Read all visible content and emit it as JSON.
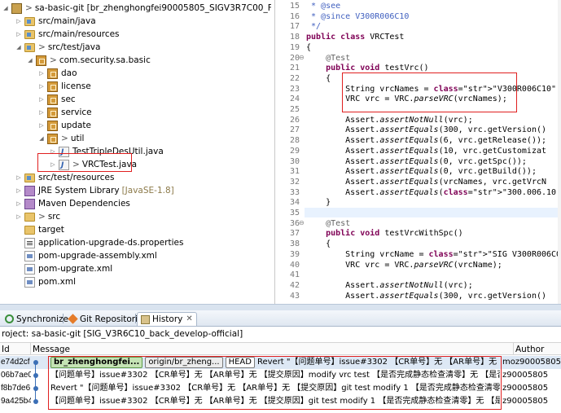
{
  "explorer": {
    "items": [
      {
        "label": "sa-basic-git [br_zhenghongfei90005805_SIGV3R7C00_F1]",
        "prefix": ">",
        "icon": "project-icon",
        "twisty": "expanded"
      },
      {
        "label": "src/main/java",
        "prefix": "",
        "icon": "source-folder-icon",
        "twisty": "collapsed"
      },
      {
        "label": "src/main/resources",
        "prefix": "",
        "icon": "source-folder-icon",
        "twisty": "collapsed"
      },
      {
        "label": "src/test/java",
        "prefix": ">",
        "icon": "source-folder-icon",
        "twisty": "expanded"
      },
      {
        "label": "com.security.sa.basic",
        "prefix": ">",
        "icon": "package-icon",
        "twisty": "expanded"
      },
      {
        "label": "dao",
        "prefix": "",
        "icon": "package-icon",
        "twisty": "collapsed"
      },
      {
        "label": "license",
        "prefix": "",
        "icon": "package-icon",
        "twisty": "collapsed"
      },
      {
        "label": "sec",
        "prefix": "",
        "icon": "package-icon",
        "twisty": "collapsed"
      },
      {
        "label": "service",
        "prefix": "",
        "icon": "package-icon",
        "twisty": "collapsed"
      },
      {
        "label": "update",
        "prefix": "",
        "icon": "package-icon",
        "twisty": "collapsed"
      },
      {
        "label": "util",
        "prefix": ">",
        "icon": "package-icon",
        "twisty": "expanded"
      },
      {
        "label": "TestTripleDesUtil.java",
        "prefix": "",
        "icon": "java-file-icon",
        "twisty": "collapsed"
      },
      {
        "label": "VRCTest.java",
        "prefix": ">",
        "icon": "java-file-icon",
        "twisty": "collapsed"
      },
      {
        "label": "src/test/resources",
        "prefix": "",
        "icon": "source-folder-icon",
        "twisty": "collapsed"
      },
      {
        "label": "JRE System Library",
        "suffix": "[JavaSE-1.8]",
        "prefix": "",
        "icon": "library-icon",
        "twisty": "collapsed"
      },
      {
        "label": "Maven Dependencies",
        "prefix": "",
        "icon": "library-icon",
        "twisty": "collapsed"
      },
      {
        "label": "src",
        "prefix": ">",
        "icon": "folder-icon",
        "twisty": "collapsed"
      },
      {
        "label": "target",
        "prefix": "",
        "icon": "folder-icon",
        "twisty": "none"
      },
      {
        "label": "application-upgrade-ds.properties",
        "prefix": "",
        "icon": "properties-file-icon",
        "twisty": "none"
      },
      {
        "label": "pom-upgrade-assembly.xml",
        "prefix": "",
        "icon": "xml-file-icon",
        "twisty": "none"
      },
      {
        "label": "pom-upgrate.xml",
        "prefix": "",
        "icon": "xml-file-icon",
        "twisty": "none"
      },
      {
        "label": "pom.xml",
        "prefix": "",
        "icon": "xml-file-icon",
        "twisty": "none"
      }
    ]
  },
  "editor": {
    "lines": [
      {
        "n": "15",
        "code": " * @see",
        "style": "comment"
      },
      {
        "n": "16",
        "code": " * @since V300R006C10",
        "style": "comment"
      },
      {
        "n": "17",
        "code": " */",
        "style": "comment"
      },
      {
        "n": "18",
        "code": "public class VRCTest",
        "style": "class"
      },
      {
        "n": "19",
        "code": "{",
        "style": "plain"
      },
      {
        "n": "20",
        "code": "    @Test",
        "style": "annotation",
        "fold": true
      },
      {
        "n": "21",
        "code": "    public void testVrc()",
        "style": "method"
      },
      {
        "n": "22",
        "code": "    {",
        "style": "plain"
      },
      {
        "n": "23",
        "code": "        String vrcNames = \"V300R006C10\";",
        "style": "string-assign"
      },
      {
        "n": "24",
        "code": "        VRC vrc = VRC.parseVRC(vrcNames);",
        "style": "italic-call"
      },
      {
        "n": "25",
        "code": "",
        "style": "plain"
      },
      {
        "n": "26",
        "code": "        Assert.assertNotNull(vrc);",
        "style": "italic-call"
      },
      {
        "n": "27",
        "code": "        Assert.assertEquals(300, vrc.getVersion()",
        "style": "italic-call"
      },
      {
        "n": "28",
        "code": "        Assert.assertEquals(6, vrc.getRelease());",
        "style": "italic-call"
      },
      {
        "n": "29",
        "code": "        Assert.assertEquals(10, vrc.getCustomizat",
        "style": "italic-call"
      },
      {
        "n": "30",
        "code": "        Assert.assertEquals(0, vrc.getSpc());",
        "style": "italic-call"
      },
      {
        "n": "31",
        "code": "        Assert.assertEquals(0, vrc.getBuild());",
        "style": "italic-call"
      },
      {
        "n": "32",
        "code": "        Assert.assertEquals(vrcNames, vrc.getVrcN",
        "style": "italic-call"
      },
      {
        "n": "33",
        "code": "        Assert.assertEquals(\"300.006.10.000.000\",",
        "style": "italic-string"
      },
      {
        "n": "34",
        "code": "    }",
        "style": "plain"
      },
      {
        "n": "35",
        "code": "",
        "style": "plain"
      },
      {
        "n": "36",
        "code": "    @Test",
        "style": "annotation",
        "fold": true
      },
      {
        "n": "37",
        "code": "    public void testVrcWithSpc()",
        "style": "method"
      },
      {
        "n": "38",
        "code": "    {",
        "style": "plain"
      },
      {
        "n": "39",
        "code": "        String vrcName = \"SIG V300R006C00SPC200\";",
        "style": "string-assign"
      },
      {
        "n": "40",
        "code": "        VRC vrc = VRC.parseVRC(vrcName);",
        "style": "italic-call"
      },
      {
        "n": "41",
        "code": "",
        "style": "plain"
      },
      {
        "n": "42",
        "code": "        Assert.assertNotNull(vrc);",
        "style": "italic-call"
      },
      {
        "n": "43",
        "code": "        Assert.assertEquals(300, vrc.getVersion()",
        "style": "italic-call"
      }
    ]
  },
  "history_view": {
    "tabs": [
      {
        "label": "Synchronize",
        "icon": "sync-icon",
        "active": false
      },
      {
        "label": "Git Repositories",
        "icon": "git-icon",
        "active": false
      },
      {
        "label": "History",
        "icon": "history-icon",
        "active": true,
        "close": "✕"
      }
    ],
    "project_line": "roject: sa-basic-git [SIG_V3R6C10_back_develop-official]",
    "columns": {
      "id": "Id",
      "message": "Message",
      "author": "Author"
    },
    "rows": [
      {
        "id": "e74d2cf",
        "refs": [
          {
            "label": "br_zhenghongfei...",
            "kind": "local"
          },
          {
            "label": "origin/br_zheng...",
            "kind": "remote"
          },
          {
            "label": "HEAD",
            "kind": "head"
          }
        ],
        "message": "Revert \"【问题单号】issue#3302 【CR单号】无 【AR单号】无 【提交原因】",
        "author": "moz90005805",
        "selected": true
      },
      {
        "id": "06b7ae0",
        "refs": [],
        "message": "【问题单号】issue#3302 【CR单号】无 【AR单号】无 【提交原因】modify vrc test 【是否完成静态检查清零】无 【是否完成验证】",
        "author": "z90005805",
        "selected": false
      },
      {
        "id": "f8b7de6",
        "refs": [],
        "message": "Revert \"【问题单号】issue#3302 【CR单号】无 【AR单号】无 【提交原因】git test modify 1 【是否完成静态检查清零】无 【是否完成",
        "author": "z90005805",
        "selected": false
      },
      {
        "id": "9a425b42",
        "refs": [],
        "message": "【问题单号】issue#3302 【CR单号】无 【AR单号】无 【提交原因】git test modify 1 【是否完成静态检查清零】无 【是否完成验证",
        "author": "z90005805",
        "selected": false
      }
    ]
  },
  "colors": {
    "highlight_box": "#e02020",
    "keyword": "#7f0055",
    "string": "#2a00ff",
    "comment": "#3f5fbf",
    "annotation": "#646464",
    "local_branch": "#c4e3b4"
  }
}
